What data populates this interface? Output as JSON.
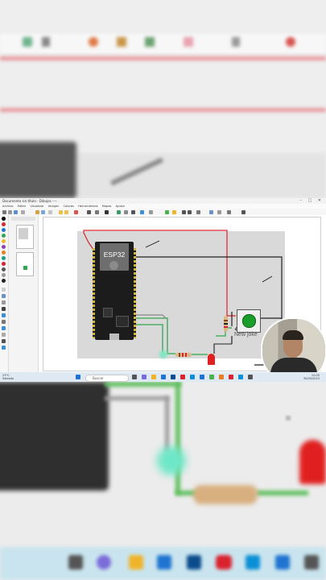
{
  "window": {
    "title": "Documento sin título - Dibujos ----",
    "controls": "–  □  ✕"
  },
  "menu": [
    "Archivo",
    "Editar",
    "Visualizar",
    "Imagen",
    "Colores",
    "Herramientas",
    "Mapas",
    "Ayuda"
  ],
  "canvas": {
    "board_label": "ESP32",
    "button_label": "New joke"
  },
  "taskbar": {
    "weather_temp": "23°C",
    "weather_desc": "Soleado",
    "search_placeholder": "Buscar",
    "time": "12:05",
    "date": "30/05/2023"
  },
  "colors": {
    "accent_red": "#d9232e",
    "wire_green": "#2fa84f",
    "wire_black": "#222222",
    "button_green": "#1a9e2a"
  }
}
